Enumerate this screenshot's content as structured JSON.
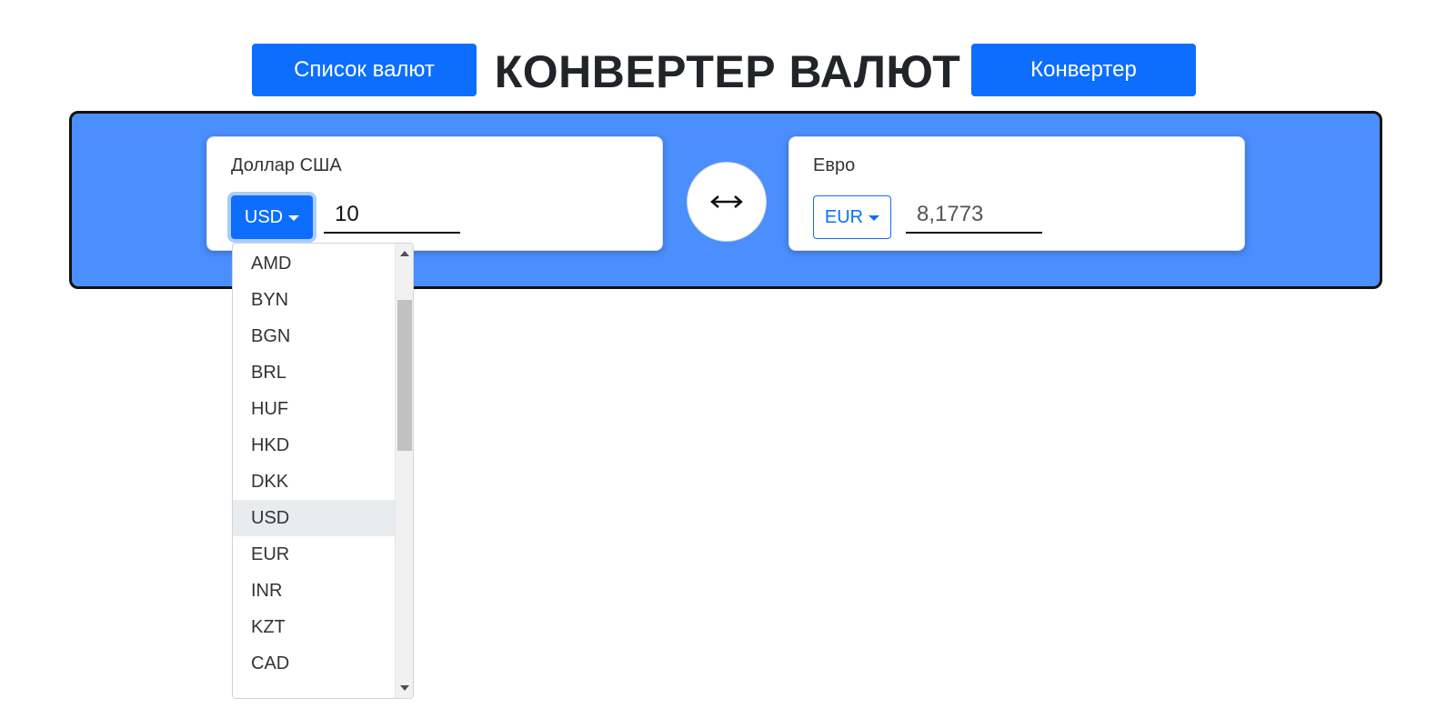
{
  "header": {
    "title": "КОНВЕРТЕР ВАЛЮТ",
    "list_button": "Список валют",
    "converter_button": "Конвертер"
  },
  "converter": {
    "from": {
      "label": "Доллар США",
      "currency": "USD",
      "amount": "10"
    },
    "to": {
      "label": "Евро",
      "currency": "EUR",
      "amount": "8,1773"
    },
    "swap_icon": "double-arrow-horizontal-icon"
  },
  "dropdown": {
    "selected": "USD",
    "options": [
      "AMD",
      "BYN",
      "BGN",
      "BRL",
      "HUF",
      "HKD",
      "DKK",
      "USD",
      "EUR",
      "INR",
      "KZT",
      "CAD"
    ]
  },
  "colors": {
    "primary": "#0d6efd",
    "panel": "#4a8ffd",
    "panel_border": "#111111",
    "active_item": "#e9ecef"
  }
}
